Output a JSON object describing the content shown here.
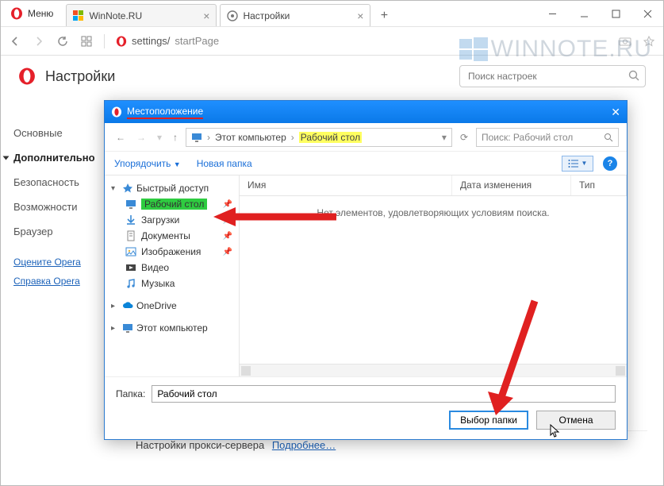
{
  "window": {
    "menu_label": "Меню",
    "tabs": [
      {
        "title": "WinNote.RU"
      },
      {
        "title": "Настройки"
      }
    ],
    "address": {
      "scheme_icon": "opera",
      "path1": "settings/",
      "path2": "startPage"
    }
  },
  "settings": {
    "title": "Настройки",
    "search_placeholder": "Поиск настроек",
    "sidebar": [
      "Основные",
      "Дополнительно",
      "Безопасность",
      "Возможности",
      "Браузер"
    ],
    "links": {
      "rate": "Оцените Opera",
      "help": "Справка Opera"
    },
    "proxy": {
      "label": "Настройки прокси-сервера",
      "more": "Подробнее…"
    }
  },
  "dialog": {
    "title": "Местоположение",
    "breadcrumb": {
      "root": "Этот компьютер",
      "leaf": "Рабочий стол"
    },
    "search_placeholder": "Поиск: Рабочий стол",
    "toolbar": {
      "organize": "Упорядочить",
      "new_folder": "Новая папка"
    },
    "tree": {
      "quick_access": "Быстрый доступ",
      "items": [
        {
          "label": "Рабочий стол",
          "icon": "desktop",
          "selected": true
        },
        {
          "label": "Загрузки",
          "icon": "downloads"
        },
        {
          "label": "Документы",
          "icon": "documents"
        },
        {
          "label": "Изображения",
          "icon": "pictures"
        },
        {
          "label": "Видео",
          "icon": "video"
        },
        {
          "label": "Музыка",
          "icon": "music"
        }
      ],
      "onedrive": "OneDrive",
      "this_pc": "Этот компьютер"
    },
    "columns": {
      "name": "Имя",
      "date": "Дата изменения",
      "type": "Тип"
    },
    "empty_text": "Нет элементов, удовлетворяющих условиям поиска.",
    "folder_label": "Папка:",
    "folder_value": "Рабочий стол",
    "buttons": {
      "select": "Выбор папки",
      "cancel": "Отмена"
    }
  },
  "watermark": "WINNOTE.RU"
}
